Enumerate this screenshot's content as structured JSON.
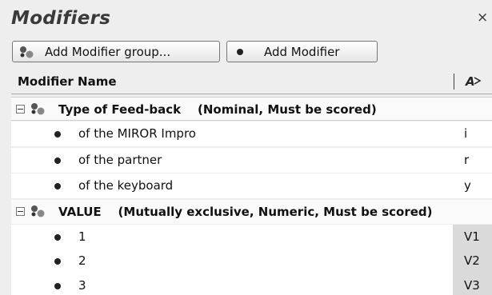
{
  "panel": {
    "title": "Modifiers",
    "close_glyph": "×"
  },
  "toolbar": {
    "add_group_label": "Add Modifier group...",
    "add_modifier_label": "Add Modifier",
    "add_group_icon": "modifier-group-icon",
    "add_modifier_icon": "bullet-icon"
  },
  "table": {
    "header": {
      "name_label": "Modifier Name",
      "sort_icon": "sort-az-icon"
    },
    "groups": [
      {
        "name": "Type of Feed-back",
        "description": "(Nominal, Must be scored)",
        "expanded": true,
        "modifiers": [
          {
            "label": "of the MIROR Impro",
            "code": "i"
          },
          {
            "label": "of the partner",
            "code": "r"
          },
          {
            "label": "of the keyboard",
            "code": "y"
          }
        ]
      },
      {
        "name": "VALUE",
        "description": "(Mutually exclusive, Numeric, Must be scored)",
        "expanded": true,
        "modifiers": [
          {
            "label": "1",
            "code": "V1"
          },
          {
            "label": "2",
            "code": "V2"
          },
          {
            "label": "3",
            "code": "V3"
          }
        ]
      }
    ]
  },
  "colors": {
    "code_shaded": "#dadada",
    "background": "#eeeeee"
  }
}
